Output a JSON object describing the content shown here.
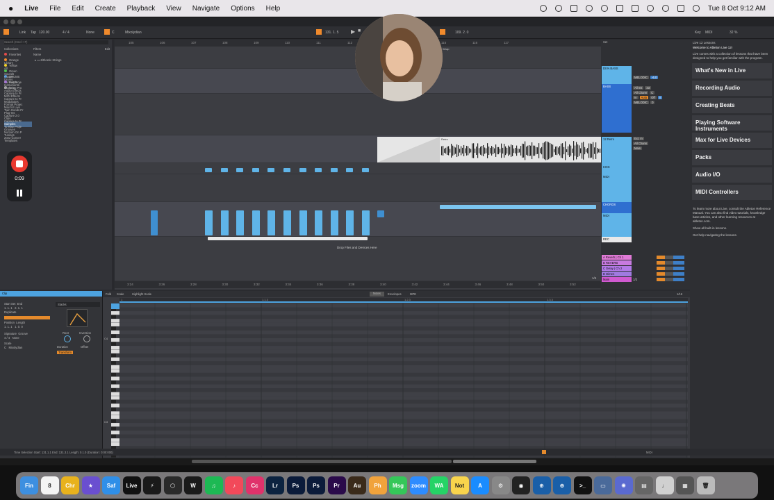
{
  "menubar": {
    "app": "Live",
    "items": [
      "File",
      "Edit",
      "Create",
      "Playback",
      "View",
      "Navigate",
      "Options",
      "Help"
    ],
    "clock": "Tue 8 Oct 9:12 AM"
  },
  "transport": {
    "link": "Link",
    "tap": "Tap",
    "tempo": "120.00",
    "signature": "4 / 4",
    "none": "None",
    "key": "C",
    "scale": "Mixolydian",
    "position": "131. 1. 5",
    "loop_len": "109. 2. 0",
    "key_label": "Key",
    "midi": "MIDI",
    "cpu": "32 %"
  },
  "browser": {
    "search_placeholder": "Search (Cmd + F)",
    "filters": "Filters",
    "edit": "Edit",
    "name_header": "Name",
    "collections_title": "Collections",
    "collections": [
      {
        "label": "Favorites",
        "color": "#e14b4b"
      },
      {
        "label": "Orange",
        "color": "#f08a2c"
      },
      {
        "label": "Yellow",
        "color": "#f0d02c"
      },
      {
        "label": "Green",
        "color": "#4fc04f"
      },
      {
        "label": "DRUMS",
        "color": "#3a8ee0"
      },
      {
        "label": "Purple",
        "color": "#a060e0"
      },
      {
        "label": "Gray",
        "color": "#999999"
      }
    ],
    "library_title": "Library",
    "library": [
      "All",
      "Sounds",
      "Drums",
      "Instruments",
      "Audio Effects",
      "MIDI Effects",
      "Modulators",
      "Max for Live",
      "Plug-Ins",
      "Clips",
      "Samples",
      "Grooves",
      "Tunings",
      "Templates"
    ],
    "places_title": "Places",
    "places": [
      "Current Proje",
      "Exploring Pro",
      "Capture to Pr",
      "Capture to Pr",
      "Format Projec",
      "Twin Goods Pr",
      "Capture 2.0",
      "Capture to Pr",
      "To Rise Proje",
      "Nocturn On P",
      "2022 Conver"
    ],
    "items": [
      {
        "label": "Zithoetic Strings",
        "depth": 0
      },
      {
        "label": "Templates",
        "depth": 0
      },
      {
        "label": "Samples",
        "depth": 0
      },
      {
        "label": "Presets",
        "depth": 0
      },
      {
        "label": "MIDI Effects",
        "depth": 1
      },
      {
        "label": "Velocity",
        "depth": 2
      },
      {
        "label": "Scale",
        "depth": 2
      },
      {
        "label": "Random",
        "depth": 2
      },
      {
        "label": "Pitch",
        "depth": 2
      },
      {
        "label": "Note Length",
        "depth": 2
      },
      {
        "label": "MIDI Effect Rack",
        "depth": 2
      },
      {
        "label": "Max MIDI Effect",
        "depth": 2
      },
      {
        "label": "Arpeggiator",
        "depth": 3
      },
      {
        "label": "MIDI Sample and Hold.adv",
        "depth": 3
      },
      {
        "label": "Chord",
        "depth": 2
      },
      {
        "label": "Arpeggiator",
        "depth": 2
      },
      {
        "label": "Instruments",
        "depth": 1
      },
      {
        "label": "Audio Effects",
        "depth": 1
      },
      {
        "label": "Grooves",
        "depth": 0
      },
      {
        "label": "GUTTER COWBOY - TÂCHES VOL. 2",
        "depth": 0
      },
      {
        "label": "FEJHA: Sample Pack - Melodic & Organic",
        "depth": 0
      },
      {
        "label": "Defaults",
        "depth": 0
      },
      {
        "label": "Daydreamer - Orga...co Production Suite",
        "depth": 0
      },
      {
        "label": "Project File",
        "depth": 1
      },
      {
        "label": "MIDI",
        "depth": 1
      },
      {
        "label": "FX's & FX",
        "depth": 1
      },
      {
        "label": "Drums",
        "depth": 1
      },
      {
        "label": "One-Shots",
        "depth": 2
      },
      {
        "label": "Tom",
        "depth": 3
      },
      {
        "label": "Shakers",
        "depth": 3
      },
      {
        "label": "Perc",
        "depth": 3
      },
      {
        "label": "Kick",
        "depth": 3
      },
      {
        "label": "Hat",
        "depth": 3
      },
      {
        "label": "OH",
        "depth": 4
      },
      {
        "label": "10 O-Hat_17_...dreamer.wav",
        "depth": 4
      },
      {
        "label": "08 O-Hat_17_...dreamer.wav",
        "depth": 4
      },
      {
        "label": "09 O-Hat_17_...dreamer.wav",
        "depth": 4
      }
    ]
  },
  "arrangement": {
    "ruler": [
      "105",
      "106",
      "107",
      "108",
      "109",
      "110",
      "111",
      "112",
      "113",
      "114",
      "115",
      "116",
      "117"
    ],
    "timeline": [
      "3:24",
      "3:26",
      "3:28",
      "3:30",
      "3:32",
      "3:34",
      "3:36",
      "3:38",
      "3:40",
      "3:42",
      "3:44",
      "3:46",
      "3:48",
      "3:50",
      "3:52"
    ],
    "drop_text": "Drop Files and Devices Here",
    "audio_clip_label": "Retro",
    "loop_label": "Wrap",
    "zoom_label": "1/4"
  },
  "mixer": {
    "set_label": "Set",
    "tracks": [
      {
        "name": "DIVA BASS",
        "color": "#5fb4e8",
        "text": "#111"
      },
      {
        "name": "BASS",
        "color": "#2f6fd0",
        "text": "#fff"
      },
      {
        "name": "12 Retro",
        "color": "#5fb4e8",
        "text": "#111"
      },
      {
        "name": "KICK",
        "color": "#5fb4e8",
        "text": "#111"
      },
      {
        "name": "MIDI",
        "color": "#5fb4e8",
        "text": "#111"
      },
      {
        "name": "CHORDS",
        "color": "#2f6fd0",
        "text": "#fff"
      },
      {
        "name": "MIDI",
        "color": "#5fb4e8",
        "text": "#111"
      },
      {
        "name": "REC",
        "color": "#e9e9e9",
        "text": "#111"
      }
    ],
    "returns": [
      {
        "name": "A Reverb | Ch 1",
        "color": "#e07ad6"
      },
      {
        "name": "B REVERB",
        "color": "#c77ae0"
      },
      {
        "name": "C Delay | Ch 2",
        "color": "#b27ae8"
      },
      {
        "name": "D Dimen",
        "color": "#a07ae0"
      },
      {
        "name": "Main",
        "color": "#d05ad0"
      }
    ],
    "routing": [
      "MELODIC",
      "All Ins",
      "All Chann",
      "In",
      "Auto",
      "Off",
      "MELODIC",
      "Ext. In",
      "All Chann",
      "Main"
    ],
    "values": [
      "-6.0",
      "33",
      "C",
      "S",
      "0"
    ],
    "fraction": "1/2"
  },
  "help": {
    "title": "Live 12 Lessons",
    "welcome": "Welcome to Ableton Live 12!",
    "intro": "Live comes with a collection of lessons that have been designed to help you get familiar with the program.",
    "lessons": [
      "What's New in Live",
      "Recording Audio",
      "Creating Beats",
      "Playing Software Instruments",
      "Max for Live Devices",
      "Packs",
      "Audio I/O",
      "MIDI Controllers"
    ],
    "more": "To learn more about Live, consult the Ableton Reference Manual. You can also find video tutorials, knowledge base articles, and other learning resources at ableton.com.",
    "show_all": "Show all built-in lessons.",
    "help_nav": "Get help navigating the lessons."
  },
  "clip_detail": {
    "title": "Clip",
    "start": "Start",
    "end": "End",
    "set": "Set",
    "start_val": "1. 1. 1",
    "end_val": "2. 1. 1",
    "duplicate": "Duplicate",
    "position": "Position",
    "length": "Length",
    "pos_val": "1. 1. 1",
    "len_val": "1. 0. 0",
    "signature": "Signature",
    "groove": "Groove",
    "sig_val": "4 / 4",
    "groove_val": "None",
    "scale": "Scale",
    "scale_key": "C",
    "scale_name": "Mixolydian",
    "device": "Stacks",
    "knob1": "Root",
    "knob2": "Inversion",
    "duration": "Duration",
    "offset": "Offset",
    "transform": "Transform"
  },
  "midi_editor": {
    "tabs": [
      "Fold",
      "Scale",
      "Highlight Scale",
      "Notes",
      "Envelopes",
      "MPE"
    ],
    "bar_labels": [
      "1",
      "1.1.3",
      "1.2.3",
      "1.3.3"
    ],
    "octaves": [
      "C4",
      "C3"
    ],
    "footer": [
      "Velocity",
      "Randomize",
      "100",
      "Ramp",
      "100",
      "127",
      "Deviation"
    ],
    "fraction": "1/16"
  },
  "status": {
    "selection": "Time Selection   Start: 131.1.1   End: 131.3.1   Length: 0.1.0 (Duration: 0:00:000)",
    "midi_label": "MIDI"
  },
  "recorder": {
    "time": "0:09"
  },
  "dock": [
    {
      "label": "Fin",
      "color": "#3d8fe0"
    },
    {
      "label": "8",
      "color": "#f4f4f4"
    },
    {
      "label": "Chr",
      "color": "#e8b21d"
    },
    {
      "label": "★",
      "color": "#6a4fd0"
    },
    {
      "label": "Saf",
      "color": "#2f8fe8"
    },
    {
      "label": "Live",
      "color": "#111111"
    },
    {
      "label": "⚡",
      "color": "#1a1a1a"
    },
    {
      "label": "⬡",
      "color": "#2a2a2a"
    },
    {
      "label": "W",
      "color": "#1a1a1a"
    },
    {
      "label": "♫",
      "color": "#1db954"
    },
    {
      "label": "♪",
      "color": "#f2495a"
    },
    {
      "label": "Cc",
      "color": "#e0326b"
    },
    {
      "label": "Lr",
      "color": "#0c2340"
    },
    {
      "label": "Ps",
      "color": "#0b1b3a"
    },
    {
      "label": "Ps",
      "color": "#0b1b3a"
    },
    {
      "label": "Pr",
      "color": "#2a0a4a"
    },
    {
      "label": "Au",
      "color": "#3a2a1a"
    },
    {
      "label": "Ph",
      "color": "#f1a33c"
    },
    {
      "label": "Msg",
      "color": "#35c759"
    },
    {
      "label": "zoom",
      "color": "#2d8cff"
    },
    {
      "label": "WA",
      "color": "#25d366"
    },
    {
      "label": "Not",
      "color": "#f8d44c"
    },
    {
      "label": "A",
      "color": "#1a8cff"
    },
    {
      "label": "⚙",
      "color": "#888888"
    },
    {
      "label": "◉",
      "color": "#222222"
    },
    {
      "label": "⊕",
      "color": "#1a5fa8"
    },
    {
      "label": "⊕",
      "color": "#1a5fa8"
    },
    {
      "label": ">_",
      "color": "#111111"
    },
    {
      "label": "▭",
      "color": "#4a6a9a"
    },
    {
      "label": "✺",
      "color": "#5a6ad0"
    },
    {
      "label": "▤",
      "color": "#666666"
    },
    {
      "label": "♩",
      "color": "#d0d0d0"
    },
    {
      "label": "▦",
      "color": "#555555"
    },
    {
      "label": "🗑",
      "color": "#bbbbbb"
    }
  ]
}
